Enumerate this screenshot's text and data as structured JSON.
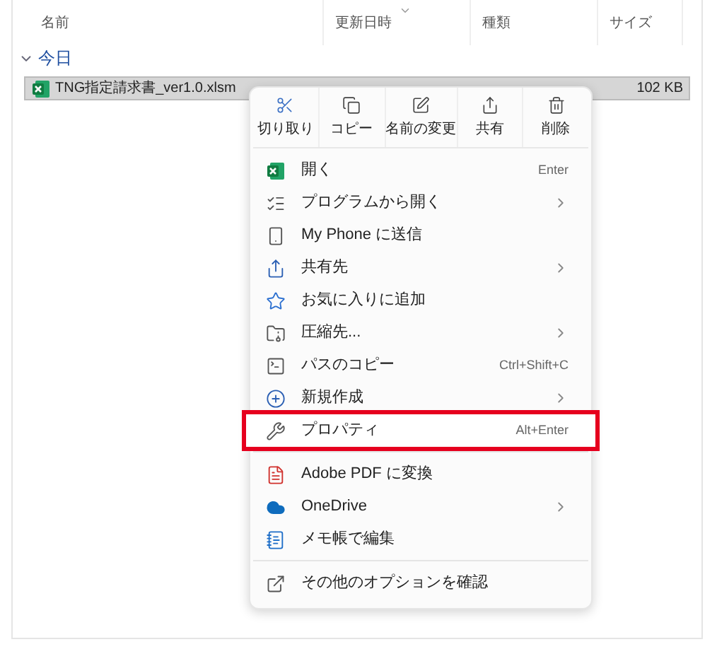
{
  "columns": [
    "名前",
    "更新日時",
    "種類",
    "サイズ"
  ],
  "group": {
    "label": "今日",
    "expanded": true
  },
  "file": {
    "name": "TNG指定請求書_ver1.0.xlsm",
    "size": "102 KB",
    "selected": true
  },
  "actions": [
    "切り取り",
    "コピー",
    "名前の変更",
    "共有",
    "削除"
  ],
  "menu_sections": [
    [
      {
        "label": "開く",
        "shortcut": "Enter",
        "submenu": false,
        "highlighted": false
      },
      {
        "label": "プログラムから開く",
        "submenu": true,
        "highlighted": false
      },
      {
        "label": "My Phone に送信",
        "submenu": false,
        "highlighted": false
      },
      {
        "label": "共有先",
        "submenu": true,
        "highlighted": false
      },
      {
        "label": "お気に入りに追加",
        "submenu": false,
        "highlighted": false
      },
      {
        "label": "圧縮先...",
        "submenu": true,
        "highlighted": false
      },
      {
        "label": "パスのコピー",
        "shortcut": "Ctrl+Shift+C",
        "submenu": false,
        "highlighted": false
      },
      {
        "label": "新規作成",
        "submenu": true,
        "highlighted": false
      },
      {
        "label": "プロパティ",
        "shortcut": "Alt+Enter",
        "submenu": false,
        "highlighted": true
      }
    ],
    [
      {
        "label": "Adobe PDF に変換",
        "submenu": false,
        "highlighted": false
      },
      {
        "label": "OneDrive",
        "submenu": true,
        "highlighted": false
      },
      {
        "label": "メモ帳で編集",
        "submenu": false,
        "highlighted": false
      }
    ],
    [
      {
        "label": "その他のオプションを確認",
        "submenu": false,
        "highlighted": false
      }
    ]
  ]
}
